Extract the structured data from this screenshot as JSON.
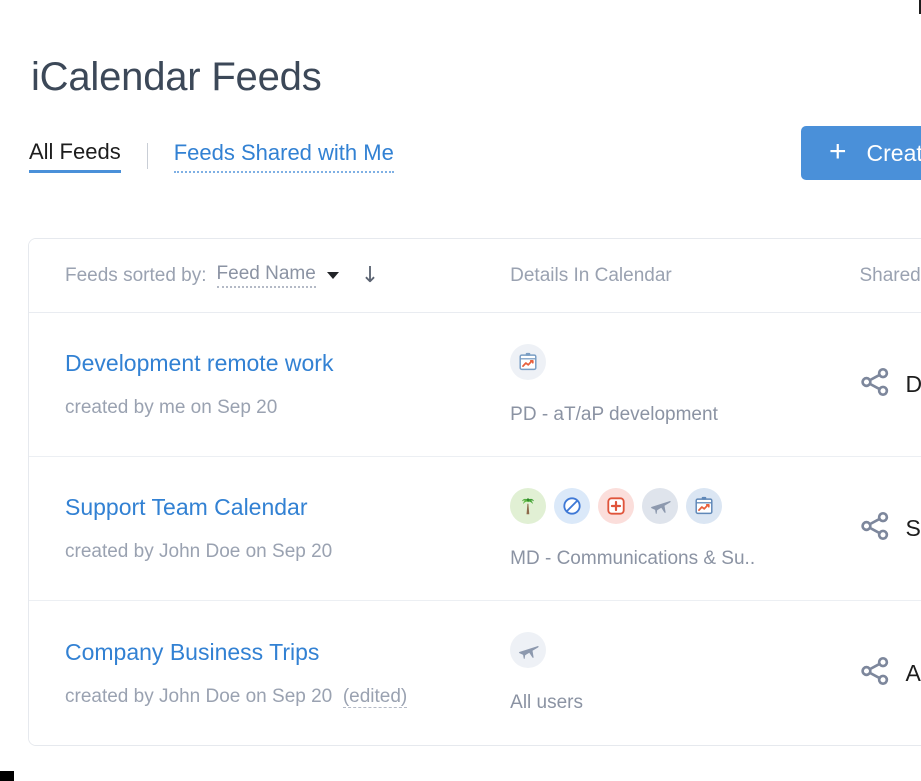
{
  "page": {
    "title": "iCalendar Feeds"
  },
  "tabs": [
    {
      "label": "All Feeds",
      "active": true
    },
    {
      "label": "Feeds Shared with Me",
      "active": false
    }
  ],
  "toolbar": {
    "create_label": "Create",
    "create_plus": "+",
    "accent_color": "#4a90d9"
  },
  "table": {
    "sort": {
      "label": "Feeds sorted by:",
      "value": "Feed Name",
      "direction_icon": "arrow-down-icon",
      "direction_glyph": "↓"
    },
    "columns": {
      "details": "Details In Calendar",
      "shared": "Shared"
    },
    "rows": [
      {
        "name": "Development remote work",
        "meta": "created by me on Sep 20",
        "edited": "",
        "icons": [
          "clipboard-chart-icon"
        ],
        "detail": "PD - aT/aP development",
        "shared": "D"
      },
      {
        "name": "Support Team Calendar",
        "meta": "created by John Doe on Sep 20",
        "edited": "",
        "icons": [
          "palm-tree-icon",
          "prohibited-icon",
          "medical-cross-icon",
          "airplane-icon",
          "clipboard-chart-icon"
        ],
        "detail": "MD - Communications & Su..",
        "shared": "S"
      },
      {
        "name": "Company Business Trips",
        "meta": "created by John Doe on Sep 20",
        "edited": "(edited)",
        "icons": [
          "airplane-icon"
        ],
        "detail": "All users",
        "shared": "A"
      }
    ]
  },
  "colors": {
    "link": "#3281d3",
    "title": "#3c4858",
    "muted": "#9aa2b1",
    "border": "#e6e9ee"
  }
}
